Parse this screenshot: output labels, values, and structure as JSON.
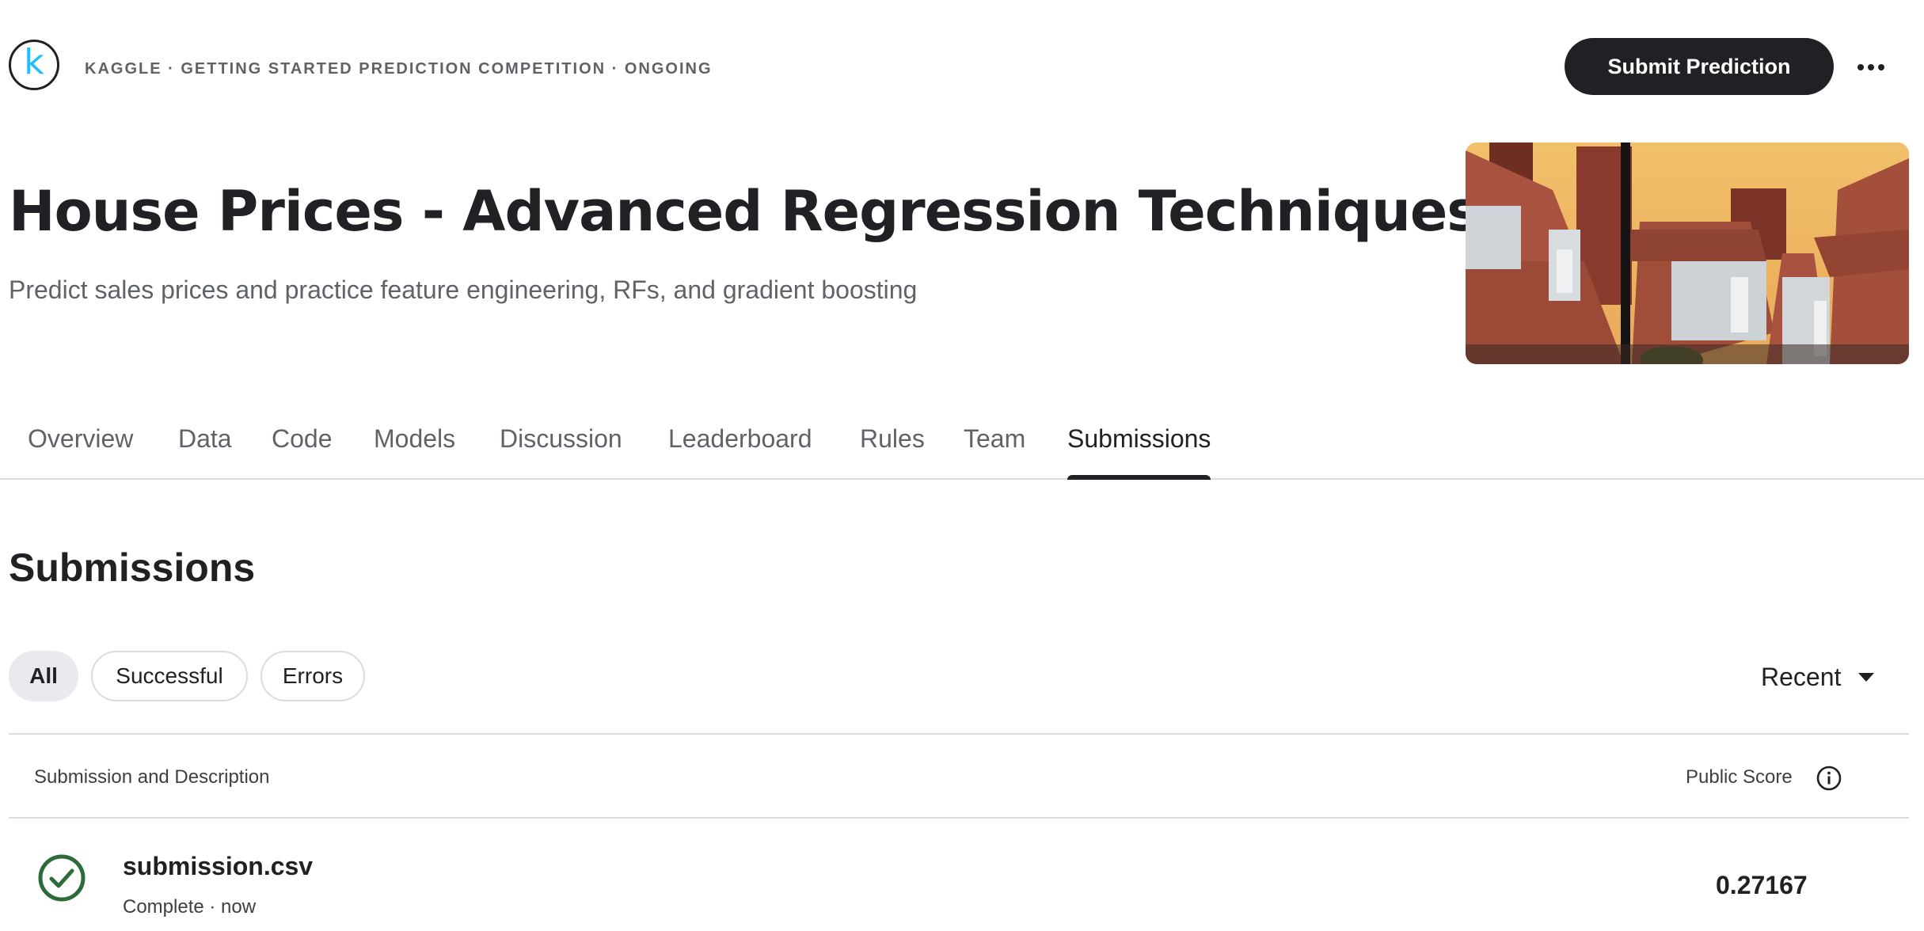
{
  "header": {
    "logo_letter": "k",
    "eyebrow": "KAGGLE · GETTING STARTED PREDICTION COMPETITION · ONGOING",
    "submit_label": "Submit Prediction",
    "more_icon": "more-horizontal-icon",
    "title": "House Prices - Advanced Regression Techniques",
    "subtitle": "Predict sales prices and practice feature engineering, RFs, and gradient boosting"
  },
  "tabs": [
    {
      "label": "Overview",
      "active": false
    },
    {
      "label": "Data",
      "active": false
    },
    {
      "label": "Code",
      "active": false
    },
    {
      "label": "Models",
      "active": false
    },
    {
      "label": "Discussion",
      "active": false
    },
    {
      "label": "Leaderboard",
      "active": false
    },
    {
      "label": "Rules",
      "active": false
    },
    {
      "label": "Team",
      "active": false
    },
    {
      "label": "Submissions",
      "active": true
    }
  ],
  "submissions": {
    "title": "Submissions",
    "filters": [
      {
        "label": "All",
        "active": true
      },
      {
        "label": "Successful",
        "active": false
      },
      {
        "label": "Errors",
        "active": false
      }
    ],
    "sort": {
      "label": "Recent",
      "icon": "caret-down-icon"
    },
    "table": {
      "col_description": "Submission and Description",
      "col_score": "Public Score",
      "info_icon": "info-icon",
      "rows": [
        {
          "file": "submission.csv",
          "status": "Complete",
          "time": "now",
          "meta": "Complete · now",
          "score": "0.27167",
          "status_icon": "check-circle-icon"
        }
      ]
    }
  },
  "colors": {
    "primary_dark": "#202124",
    "text_secondary": "#5f6368",
    "divider": "#dadce0",
    "chip_active_bg": "#e8eaed",
    "logo_accent": "#20beff",
    "success_green": "#2e6b3a"
  }
}
